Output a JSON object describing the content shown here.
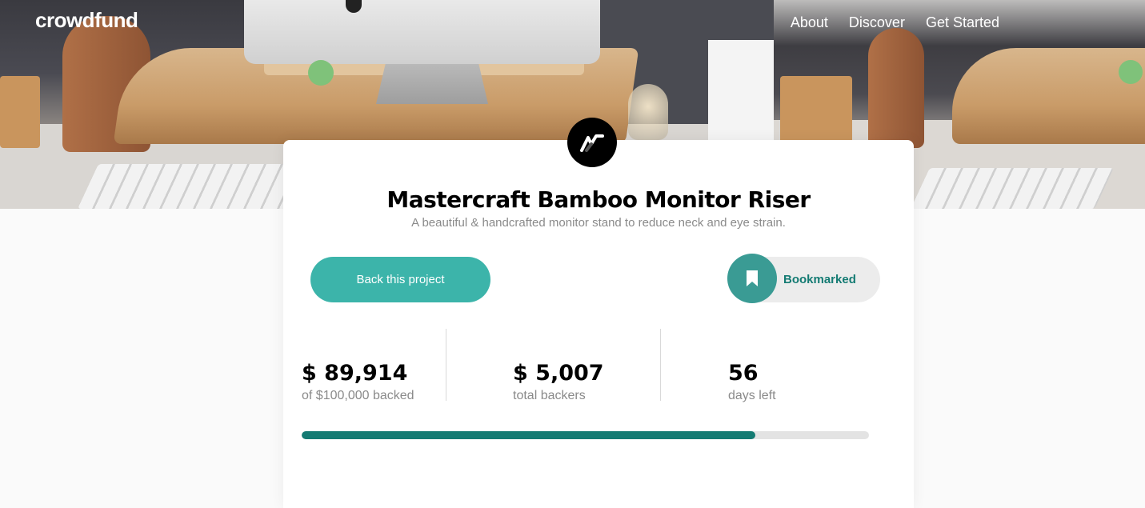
{
  "header": {
    "logo": "crowdfund",
    "nav": [
      {
        "label": "About"
      },
      {
        "label": "Discover"
      },
      {
        "label": "Get Started"
      }
    ]
  },
  "project": {
    "logo_icon": "mastercraft-logo-icon",
    "title": "Mastercraft Bamboo Monitor Riser",
    "subtitle": "A beautiful & handcrafted monitor stand to reduce neck and eye strain.",
    "back_button_label": "Back this project",
    "bookmark_icon": "bookmark-icon",
    "bookmark_label": "Bookmarked"
  },
  "stats": [
    {
      "value": "$ 89,914",
      "label": "of $100,000 backed"
    },
    {
      "value": "$ 5,007",
      "label": "total backers"
    },
    {
      "value": "56",
      "label": "days left"
    }
  ],
  "progress": {
    "fraction": 0.8
  },
  "colors": {
    "accent": "#3cb4aa",
    "accent_dark": "#147b73",
    "bookmark_circle": "#3a9b94"
  }
}
